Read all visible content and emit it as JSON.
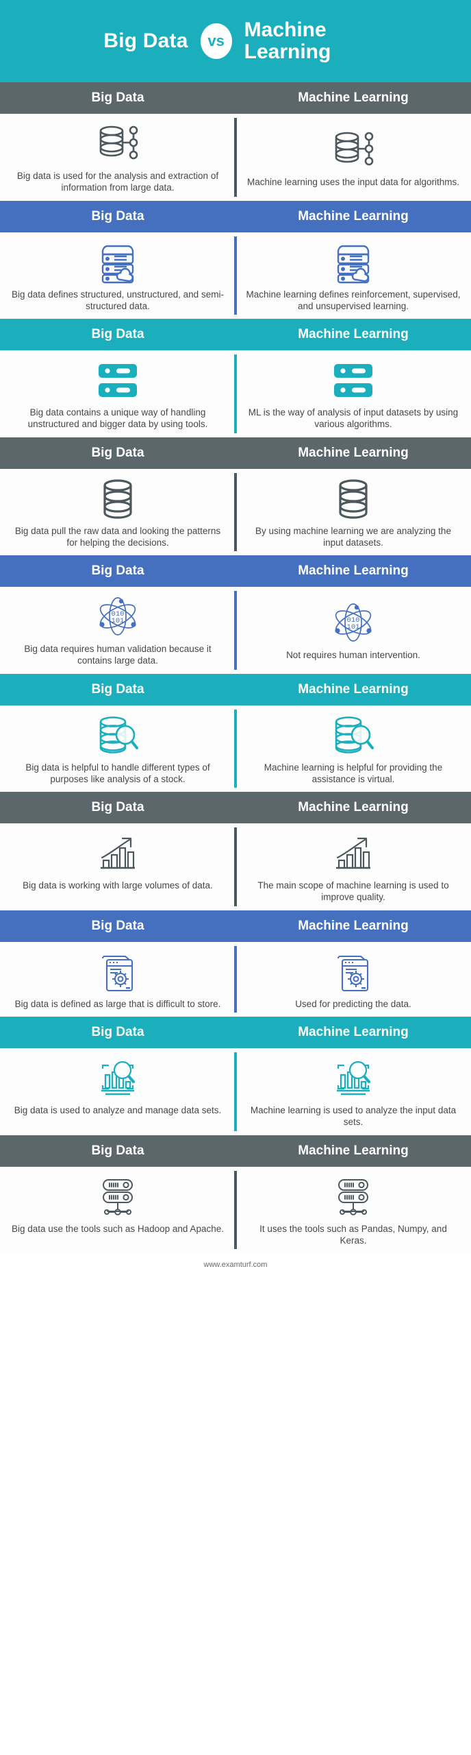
{
  "title": {
    "left": "Big Data",
    "vs": "vs",
    "right": "Machine Learning"
  },
  "column_headers": {
    "left": "Big Data",
    "right": "Machine Learning"
  },
  "colors": {
    "teal": "#1bafbd",
    "blue": "#4570c0",
    "gray": "#5c676c",
    "text": "#46474a"
  },
  "rows": [
    {
      "band_color": "gray",
      "icon": "database-nodes-icon",
      "left_text": "Big data is used for the analysis and extraction of information from large data.",
      "right_text": "Machine learning uses the input data for algorithms."
    },
    {
      "band_color": "blue",
      "icon": "server-cloud-icon",
      "left_text": "Big data defines structured, unstructured, and semi-structured data.",
      "right_text": "Machine learning defines reinforcement, supervised, and unsupervised learning."
    },
    {
      "band_color": "teal",
      "icon": "server-rack-solid-icon",
      "left_text": "Big data contains a unique way of handling unstructured and bigger data by using tools.",
      "right_text": "ML is the way of analysis of input datasets by using various algorithms."
    },
    {
      "band_color": "gray",
      "icon": "database-cylinder-icon",
      "left_text": "Big data pull the raw data and looking the patterns for helping the decisions.",
      "right_text": "By using machine learning we are analyzing the input datasets."
    },
    {
      "band_color": "blue",
      "icon": "atom-binary-icon",
      "left_text": "Big data requires human validation because it contains large data.",
      "right_text": "Not requires human intervention."
    },
    {
      "band_color": "teal",
      "icon": "database-magnifier-icon",
      "left_text": "Big data is helpful to handle different types of purposes like analysis of a stock.",
      "right_text": "Machine learning is helpful for providing the assistance is virtual."
    },
    {
      "band_color": "gray",
      "icon": "growth-chart-arrow-icon",
      "left_text": "Big data is working with large volumes of data.",
      "right_text": "The main scope of machine learning is used to improve quality."
    },
    {
      "band_color": "blue",
      "icon": "documents-gear-icon",
      "left_text": "Big data is defined as large that is difficult to store.",
      "right_text": "Used for predicting the data."
    },
    {
      "band_color": "teal",
      "icon": "chart-magnifier-icon",
      "left_text": "Big data is used to analyze and manage data sets.",
      "right_text": "Machine learning is used to analyze the input data sets."
    },
    {
      "band_color": "gray",
      "icon": "server-network-icon",
      "left_text": "Big data use the tools such as Hadoop and Apache.",
      "right_text": "It uses the tools such as Pandas, Numpy, and Keras."
    }
  ],
  "footer": {
    "text": "www.examturf.com"
  }
}
